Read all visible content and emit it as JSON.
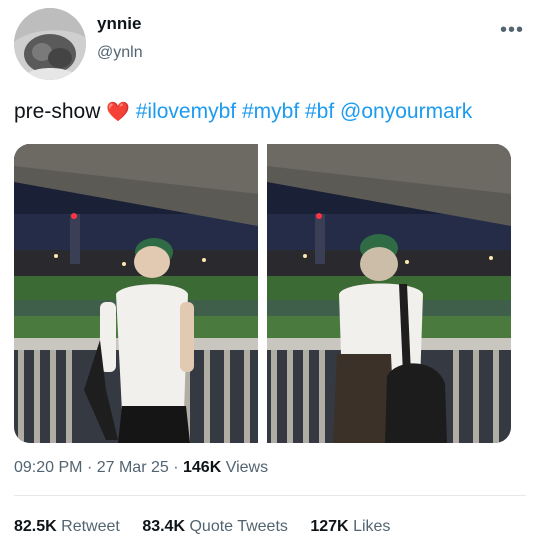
{
  "author": {
    "name": "ynnie",
    "handle": "@ynln",
    "avatar_icon": "profile-photo"
  },
  "tweet": {
    "text": "pre-show",
    "emoji": "❤️",
    "hashtags": [
      "#ilovemybf",
      "#mybf",
      "#bf"
    ],
    "mention": "@onyourmark"
  },
  "meta": {
    "time": "09:20 PM",
    "sep": "·",
    "date": "27 Mar 25",
    "views_count": "146K",
    "views_label": "Views"
  },
  "stats": [
    {
      "count": "82.5K",
      "label": "Retweet"
    },
    {
      "count": "83.4K",
      "label": "Quote Tweets"
    },
    {
      "count": "127K",
      "label": "Likes"
    }
  ],
  "colors": {
    "link": "#1d9bf0",
    "secondary": "#536471",
    "text": "#0f1419"
  }
}
